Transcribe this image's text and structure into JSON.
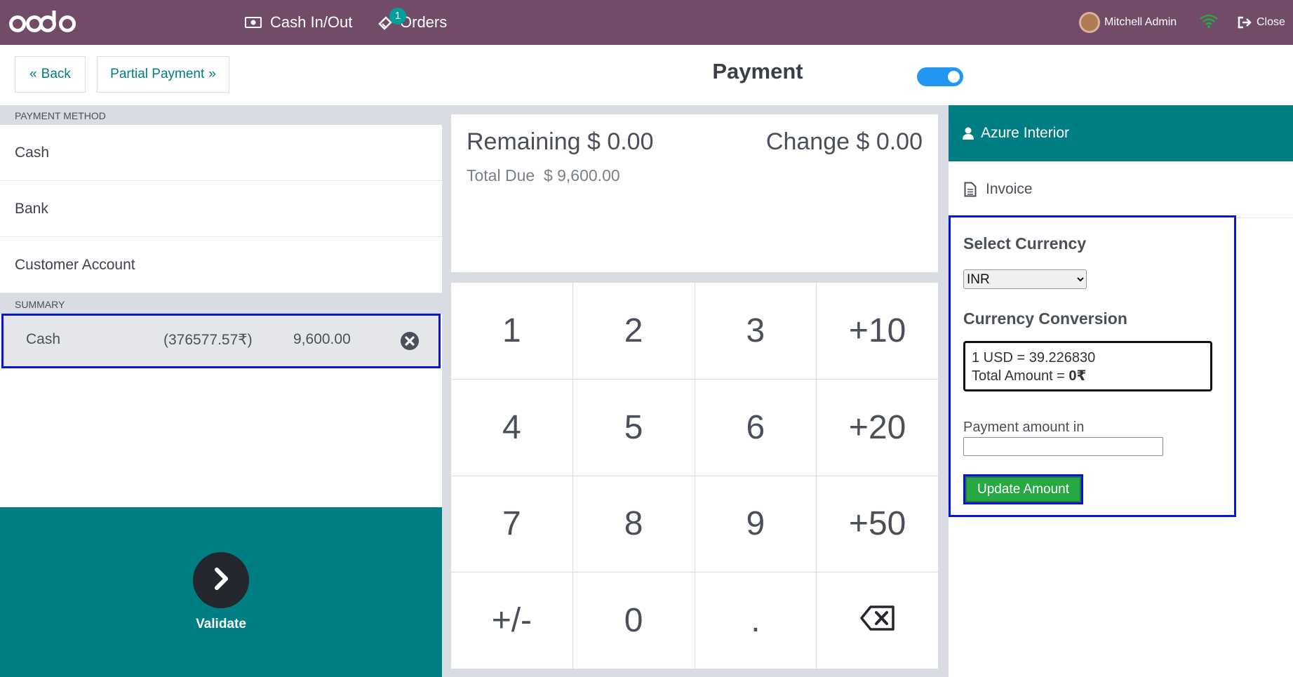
{
  "navbar": {
    "logo_text": "odoo",
    "cash_in_out": "Cash In/Out",
    "orders": "Orders",
    "orders_badge": "1",
    "user_name": "Mitchell Admin",
    "close": "Close"
  },
  "controls": {
    "back": "Back",
    "partial_payment": "Partial Payment",
    "title": "Payment"
  },
  "payment_methods": {
    "header": "PAYMENT METHOD",
    "items": [
      "Cash",
      "Bank",
      "Customer Account"
    ]
  },
  "summary": {
    "header": "SUMMARY",
    "line": {
      "method": "Cash",
      "converted": "(376577.57₹)",
      "amount": "9,600.00"
    }
  },
  "validate": {
    "label": "Validate"
  },
  "due": {
    "remaining": "Remaining $ 0.00",
    "change": "Change $ 0.00",
    "total_due": "Total Due  $ 9,600.00"
  },
  "numpad": {
    "keys": [
      "1",
      "2",
      "3",
      "+10",
      "4",
      "5",
      "6",
      "+20",
      "7",
      "8",
      "9",
      "+50",
      "+/-",
      "0",
      "."
    ]
  },
  "customer": {
    "name": "Azure Interior"
  },
  "invoice": {
    "label": "Invoice"
  },
  "currency_panel": {
    "select_title": "Select Currency",
    "selected_currency": "INR",
    "conversion_title": "Currency Conversion",
    "rate_line": "1 USD = 39.226830",
    "total_amount_prefix": "Total Amount = ",
    "total_amount_value": "0₹",
    "payment_amount_label": "Payment amount in",
    "payment_amount_value": "",
    "update_button": "Update Amount"
  },
  "colors": {
    "navbar": "#714b67",
    "teal": "#017e84",
    "toggle": "#2196f3",
    "highlight_border": "#0a14d6",
    "update_button": "#28a745"
  }
}
